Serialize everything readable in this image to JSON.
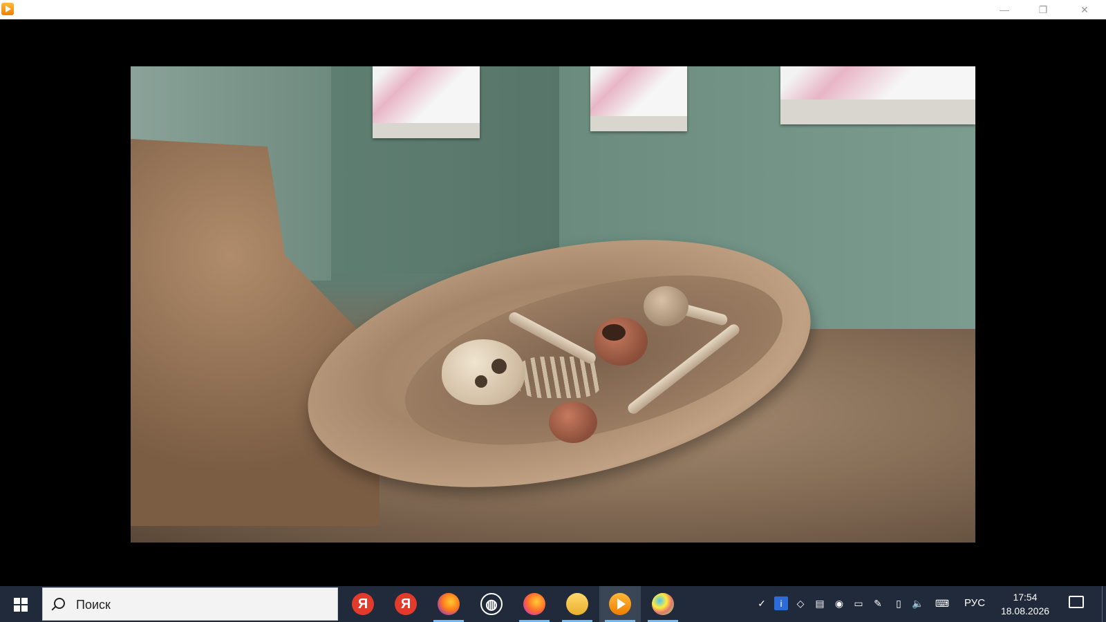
{
  "window": {
    "app_icon": "player-icon",
    "controls": {
      "minimize": "—",
      "maximize": "❐",
      "close": "✕"
    }
  },
  "video": {
    "content": "museum-exhibit-video-frame"
  },
  "taskbar": {
    "search_label": "Поиск",
    "apps": [
      {
        "name": "yandex-browser",
        "label": "Я",
        "running": false
      },
      {
        "name": "yandex",
        "label": "Я",
        "running": false
      },
      {
        "name": "firefox",
        "label": "",
        "running": true
      },
      {
        "name": "globe",
        "label": "◍",
        "running": false
      },
      {
        "name": "firefox-dev",
        "label": "",
        "running": true
      },
      {
        "name": "file-explorer",
        "label": "",
        "running": true
      },
      {
        "name": "media-player",
        "label": "",
        "running": true,
        "active": true
      },
      {
        "name": "paint",
        "label": "",
        "running": true
      }
    ],
    "tray": {
      "language": "РУС",
      "time": "17:54",
      "date": "18.08.2026"
    }
  },
  "colors": {
    "taskbar_bg": "#202a3a",
    "running_indicator": "#76b9ed",
    "player_accent": "#f07d00"
  }
}
